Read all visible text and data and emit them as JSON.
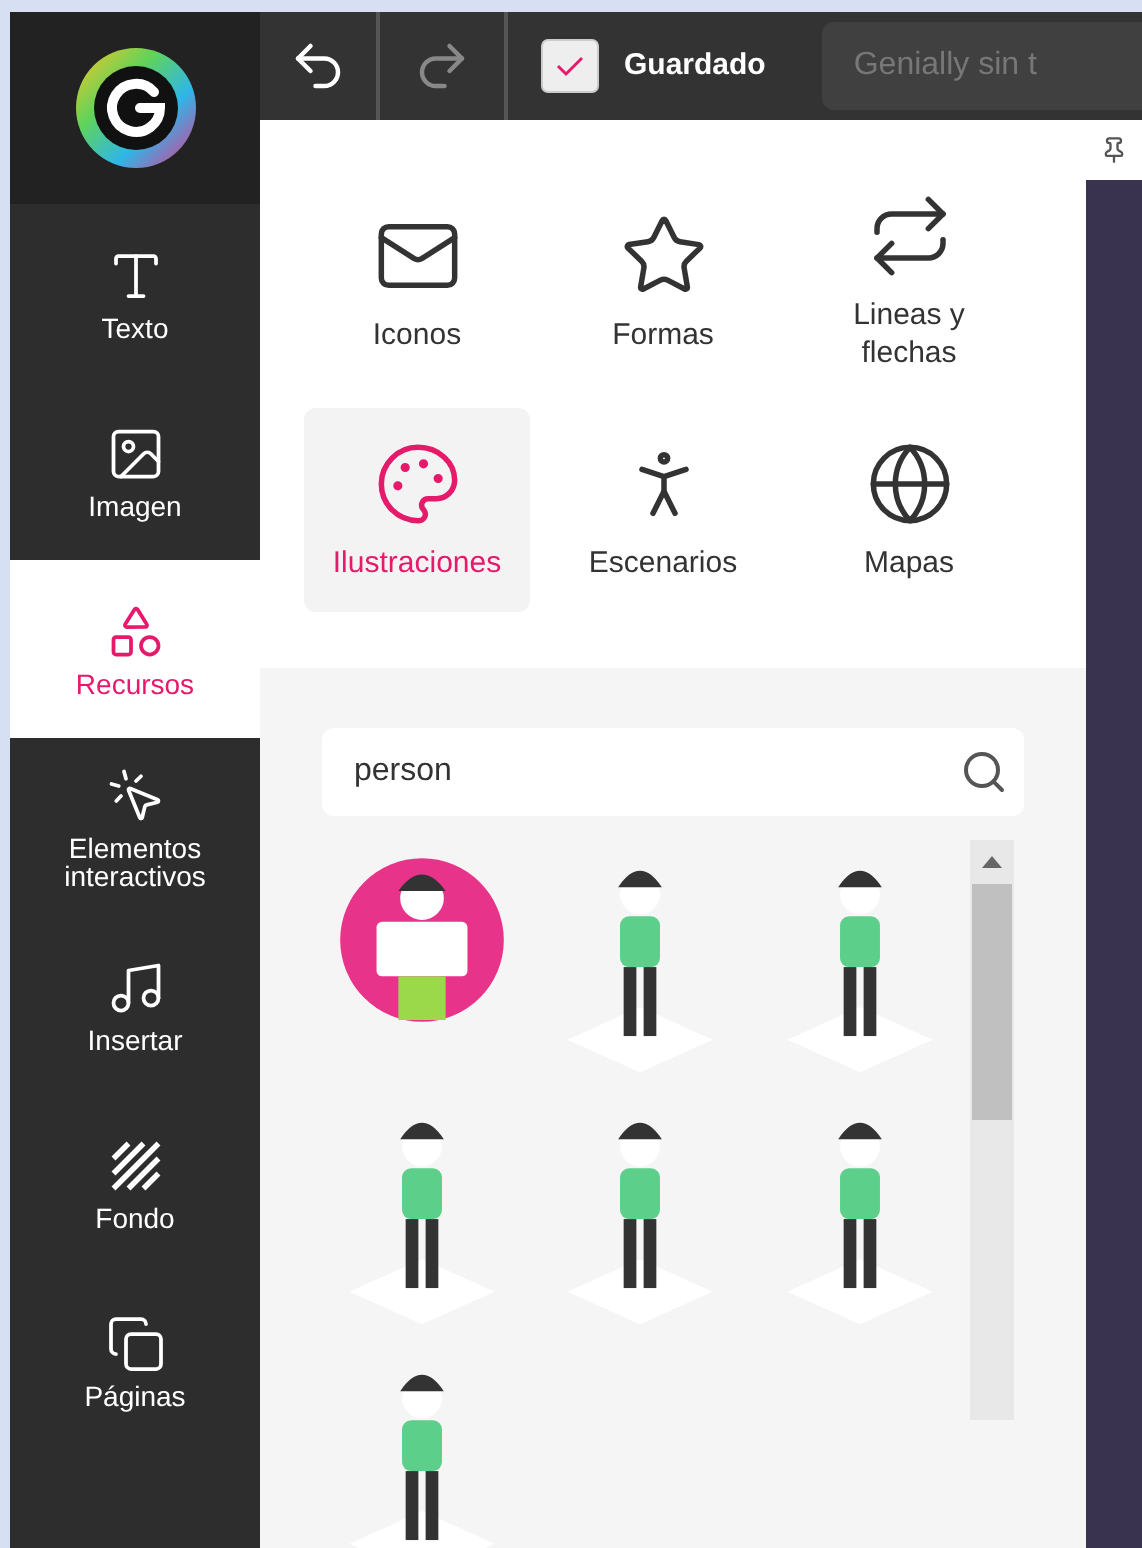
{
  "toolbar": {
    "save_status": "Guardado",
    "title_field": {
      "value": "Genially sin t"
    }
  },
  "sidebar": {
    "items": [
      {
        "kind": "text",
        "label": "Texto",
        "selected": false
      },
      {
        "kind": "image",
        "label": "Imagen",
        "selected": false
      },
      {
        "kind": "resources",
        "label": "Recursos",
        "selected": true
      },
      {
        "kind": "interactive",
        "label": "Elementos interactivos",
        "selected": false
      },
      {
        "kind": "insert",
        "label": "Insertar",
        "selected": false
      },
      {
        "kind": "background",
        "label": "Fondo",
        "selected": false
      },
      {
        "kind": "pages",
        "label": "Páginas",
        "selected": false
      }
    ]
  },
  "categories": [
    {
      "kind": "icons",
      "label": "Iconos",
      "selected": false
    },
    {
      "kind": "shapes",
      "label": "Formas",
      "selected": false
    },
    {
      "kind": "lines",
      "label": "Lineas y flechas",
      "selected": false
    },
    {
      "kind": "illustrations",
      "label": "Ilustraciones",
      "selected": true
    },
    {
      "kind": "scenes",
      "label": "Escenarios",
      "selected": false
    },
    {
      "kind": "maps",
      "label": "Mapas",
      "selected": false
    }
  ],
  "search": {
    "value": "person"
  },
  "illustrations": [
    {
      "kind": "badge"
    },
    {
      "kind": "person"
    },
    {
      "kind": "person"
    },
    {
      "kind": "person"
    },
    {
      "kind": "person"
    },
    {
      "kind": "person"
    },
    {
      "kind": "person"
    }
  ]
}
